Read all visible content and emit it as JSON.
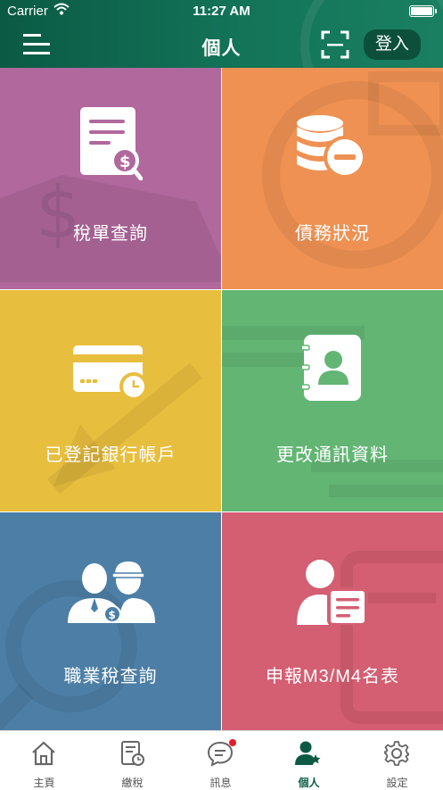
{
  "status_bar": {
    "carrier": "Carrier",
    "time": "11:27 AM"
  },
  "header": {
    "title": "個人",
    "login_label": "登入"
  },
  "tiles": [
    {
      "label": "稅單查詢",
      "color": "#b0689d"
    },
    {
      "label": "債務狀況",
      "color": "#ee9152"
    },
    {
      "label": "已登記銀行帳戶",
      "color": "#e8be3e"
    },
    {
      "label": "更改通訊資料",
      "color": "#63b574"
    },
    {
      "label": "職業稅查詢",
      "color": "#4d7fa6"
    },
    {
      "label": "申報M3/M4名表",
      "color": "#d45e72"
    }
  ],
  "tabbar": {
    "items": [
      {
        "label": "主頁",
        "icon": "home-icon"
      },
      {
        "label": "繳稅",
        "icon": "tax-bill-icon"
      },
      {
        "label": "訊息",
        "icon": "message-icon"
      },
      {
        "label": "個人",
        "icon": "personal-icon"
      },
      {
        "label": "設定",
        "icon": "settings-icon"
      }
    ],
    "active": "個人"
  }
}
